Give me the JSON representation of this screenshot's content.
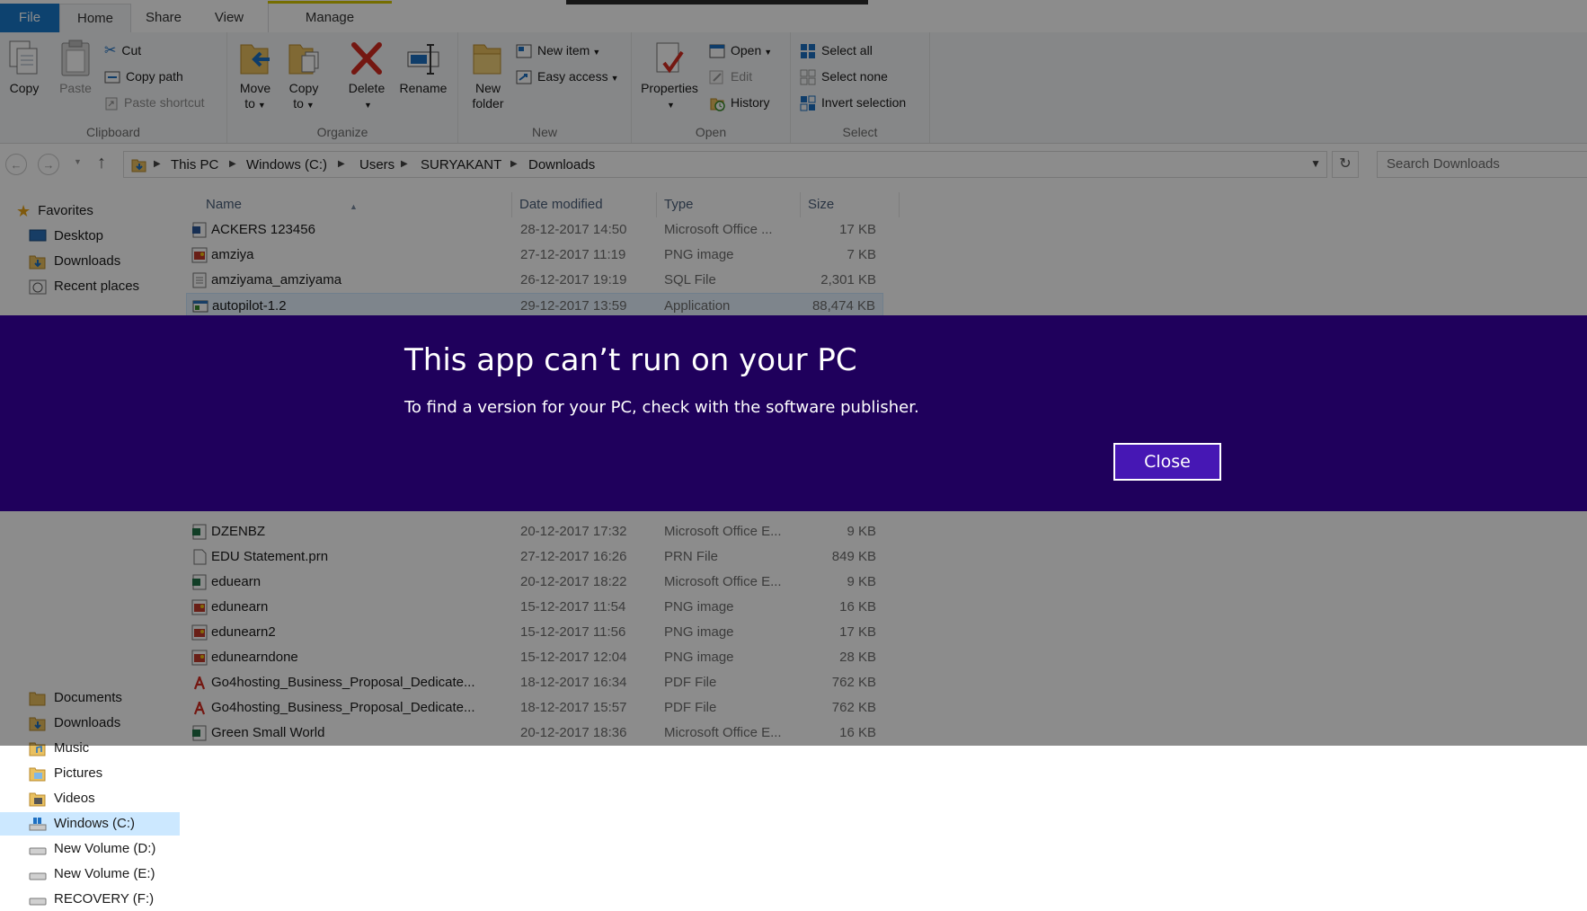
{
  "tabs": {
    "file": "File",
    "home": "Home",
    "share": "Share",
    "view": "View",
    "manage": "Manage"
  },
  "ribbon": {
    "clipboard": {
      "label": "Clipboard",
      "copy": "Copy",
      "paste": "Paste",
      "cut": "Cut",
      "copy_path": "Copy path",
      "paste_shortcut": "Paste shortcut"
    },
    "organize": {
      "label": "Organize",
      "move_to": [
        "Move",
        "to"
      ],
      "copy_to": [
        "Copy",
        "to"
      ],
      "delete": "Delete",
      "rename": "Rename"
    },
    "new": {
      "label": "New",
      "new_folder": [
        "New",
        "folder"
      ],
      "new_item": "New item",
      "easy_access": "Easy access"
    },
    "open": {
      "label": "Open",
      "properties": "Properties",
      "open": "Open",
      "edit": "Edit",
      "history": "History"
    },
    "select": {
      "label": "Select",
      "select_all": "Select all",
      "select_none": "Select none",
      "invert": "Invert selection"
    }
  },
  "address": {
    "crumbs": [
      "This PC",
      "Windows (C:)",
      "Users",
      "SURYAKANT",
      "Downloads"
    ],
    "search_placeholder": "Search Downloads"
  },
  "nav": {
    "favorites": "Favorites",
    "desktop": "Desktop",
    "downloads": "Downloads",
    "recent": "Recent places",
    "documents": "Documents",
    "downloads2": "Downloads",
    "music": "Music",
    "pictures": "Pictures",
    "videos": "Videos",
    "drive_c": "Windows (C:)",
    "drive_d": "New Volume (D:)",
    "drive_e": "New Volume (E:)",
    "drive_f": "RECOVERY (F:)"
  },
  "columns": {
    "name": "Name",
    "date": "Date modified",
    "type": "Type",
    "size": "Size"
  },
  "files": [
    {
      "name": "ACKERS  123456",
      "date": "28-12-2017 14:50",
      "type": "Microsoft Office ...",
      "size": "17 KB"
    },
    {
      "name": "amziya",
      "date": "27-12-2017 11:19",
      "type": "PNG image",
      "size": "7 KB"
    },
    {
      "name": "amziyama_amziyama",
      "date": "26-12-2017 19:19",
      "type": "SQL File",
      "size": "2,301 KB"
    },
    {
      "name": "autopilot-1.2",
      "date": "29-12-2017 13:59",
      "type": "Application",
      "size": "88,474 KB"
    },
    {
      "name": "DZENBZ",
      "date": "20-12-2017 17:32",
      "type": "Microsoft Office E...",
      "size": "9 KB"
    },
    {
      "name": "EDU Statement.prn",
      "date": "27-12-2017 16:26",
      "type": "PRN File",
      "size": "849 KB"
    },
    {
      "name": "eduearn",
      "date": "20-12-2017 18:22",
      "type": "Microsoft Office E...",
      "size": "9 KB"
    },
    {
      "name": "edunearn",
      "date": "15-12-2017 11:54",
      "type": "PNG image",
      "size": "16 KB"
    },
    {
      "name": "edunearn2",
      "date": "15-12-2017 11:56",
      "type": "PNG image",
      "size": "17 KB"
    },
    {
      "name": "edunearndone",
      "date": "15-12-2017 12:04",
      "type": "PNG image",
      "size": "28 KB"
    },
    {
      "name": "Go4hosting_Business_Proposal_Dedicate...",
      "date": "18-12-2017 16:34",
      "type": "PDF File",
      "size": "762 KB"
    },
    {
      "name": "Go4hosting_Business_Proposal_Dedicate...",
      "date": "18-12-2017 15:57",
      "type": "PDF File",
      "size": "762 KB"
    },
    {
      "name": "Green Small World",
      "date": "20-12-2017 18:36",
      "type": "Microsoft Office E...",
      "size": "16 KB"
    }
  ],
  "dialog": {
    "title": "This app can’t run on your PC",
    "message": "To find a version for your PC, check with the software publisher.",
    "close": "Close",
    "bg_color": "#1f005c",
    "button_color": "#4617b4"
  }
}
